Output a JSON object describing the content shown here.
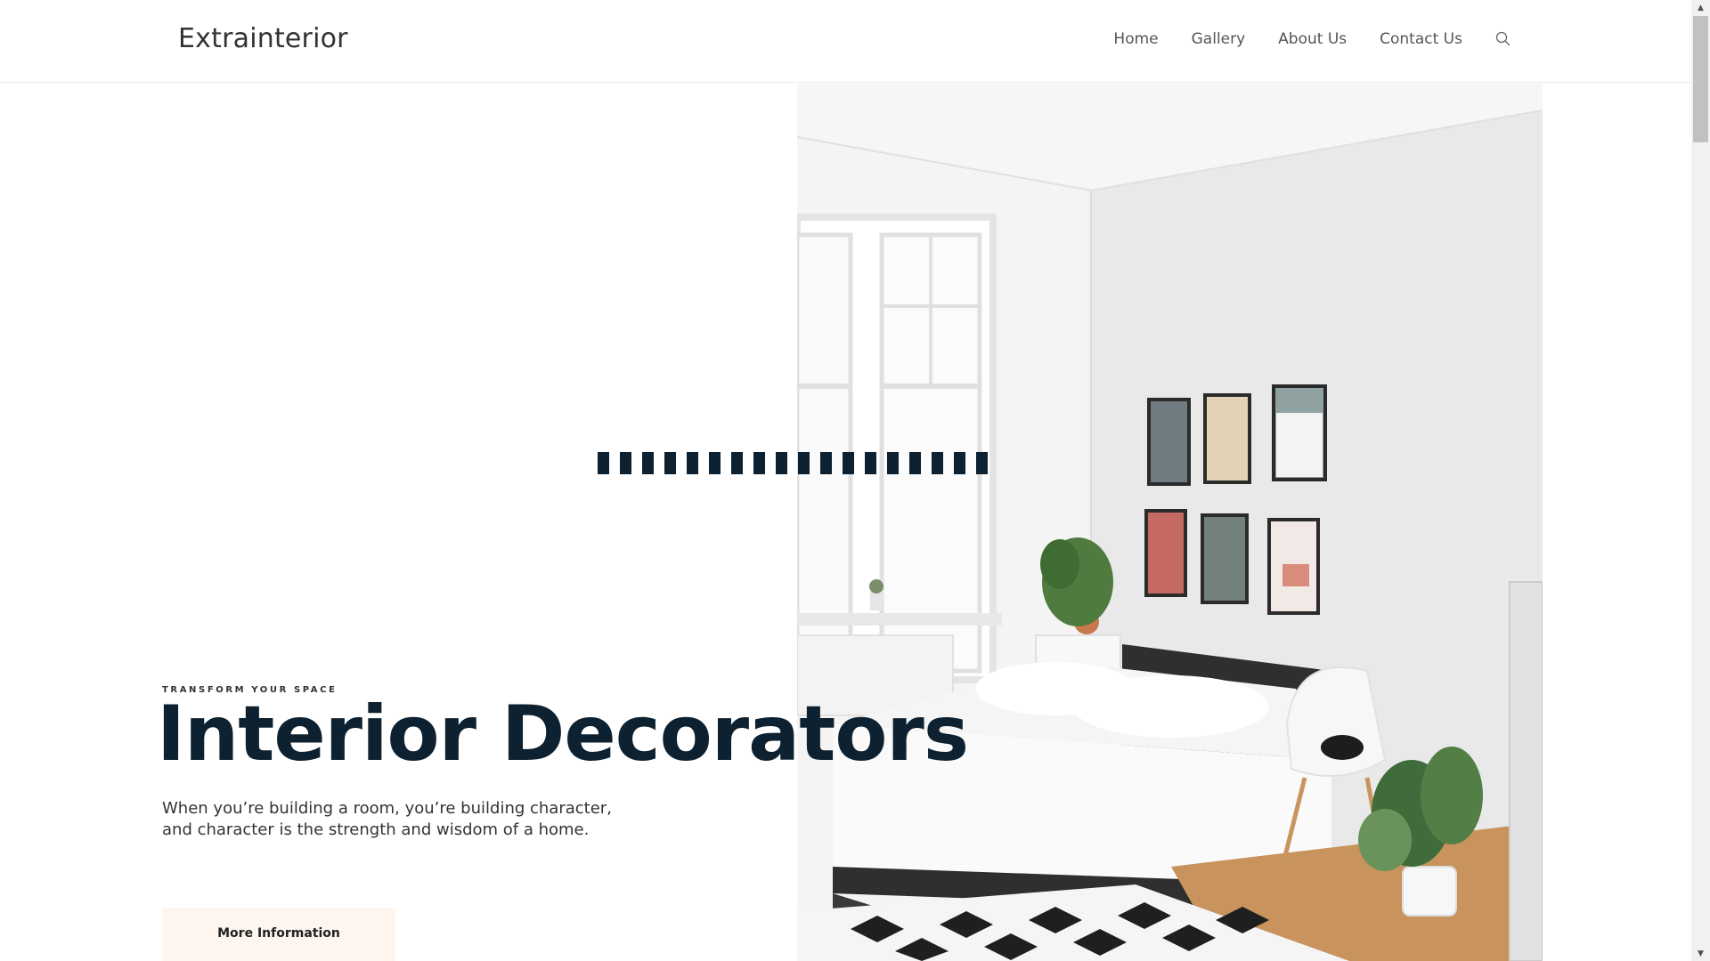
{
  "header": {
    "logo": "Extrainterior",
    "nav": [
      "Home",
      "Gallery",
      "About Us",
      "Contact Us"
    ],
    "search_icon": "search-icon"
  },
  "hero": {
    "eyebrow": "TRANSFORM YOUR SPACE",
    "title": "Interior Decorators",
    "description": "When you’re building a room, you’re building character, and character is the strength and wisdom of a home.",
    "cta_label": "More Information",
    "image_icon": "bedroom-photo"
  },
  "colors": {
    "title": "#0d2130",
    "cta_background": "#fdf5ee",
    "text": "#333333"
  }
}
